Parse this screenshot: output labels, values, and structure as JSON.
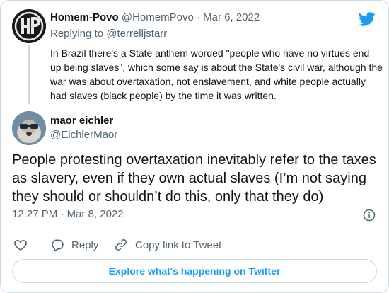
{
  "parent_tweet": {
    "name": "Homem-Povo",
    "handle": "@HomemPovo",
    "separator": "·",
    "date": "Mar 6, 2022",
    "replying_prefix": "Replying to",
    "replying_to": "@terrelljstarr",
    "text": "In Brazil there's a State anthem worded \"people who have no virtues end up being slaves\", which some say is about the State's civil war, although the war was about overtaxation, not enslavement, and white people actually had slaves (black people) by the time it was written."
  },
  "main_tweet": {
    "name": "maor eichler",
    "handle": "@EichlerMaor",
    "text": "People protesting overtaxation inevitably refer to the taxes as slavery, even if they own actual slaves (I’m not saying they should or shouldn’t do this, only that they do)",
    "time": "12:27 PM",
    "separator": "·",
    "date": "Mar 8, 2022"
  },
  "actions": {
    "reply_label": "Reply",
    "copy_label": "Copy link to Tweet"
  },
  "explore_label": "Explore what's happening on Twitter",
  "colors": {
    "twitter_blue": "#1d9bf0",
    "text_primary": "#0f1419",
    "text_secondary": "#536471",
    "border": "#cfd9de"
  },
  "icons": [
    "twitter-bird-icon",
    "info-icon",
    "heart-icon",
    "reply-bubble-icon",
    "link-icon"
  ]
}
